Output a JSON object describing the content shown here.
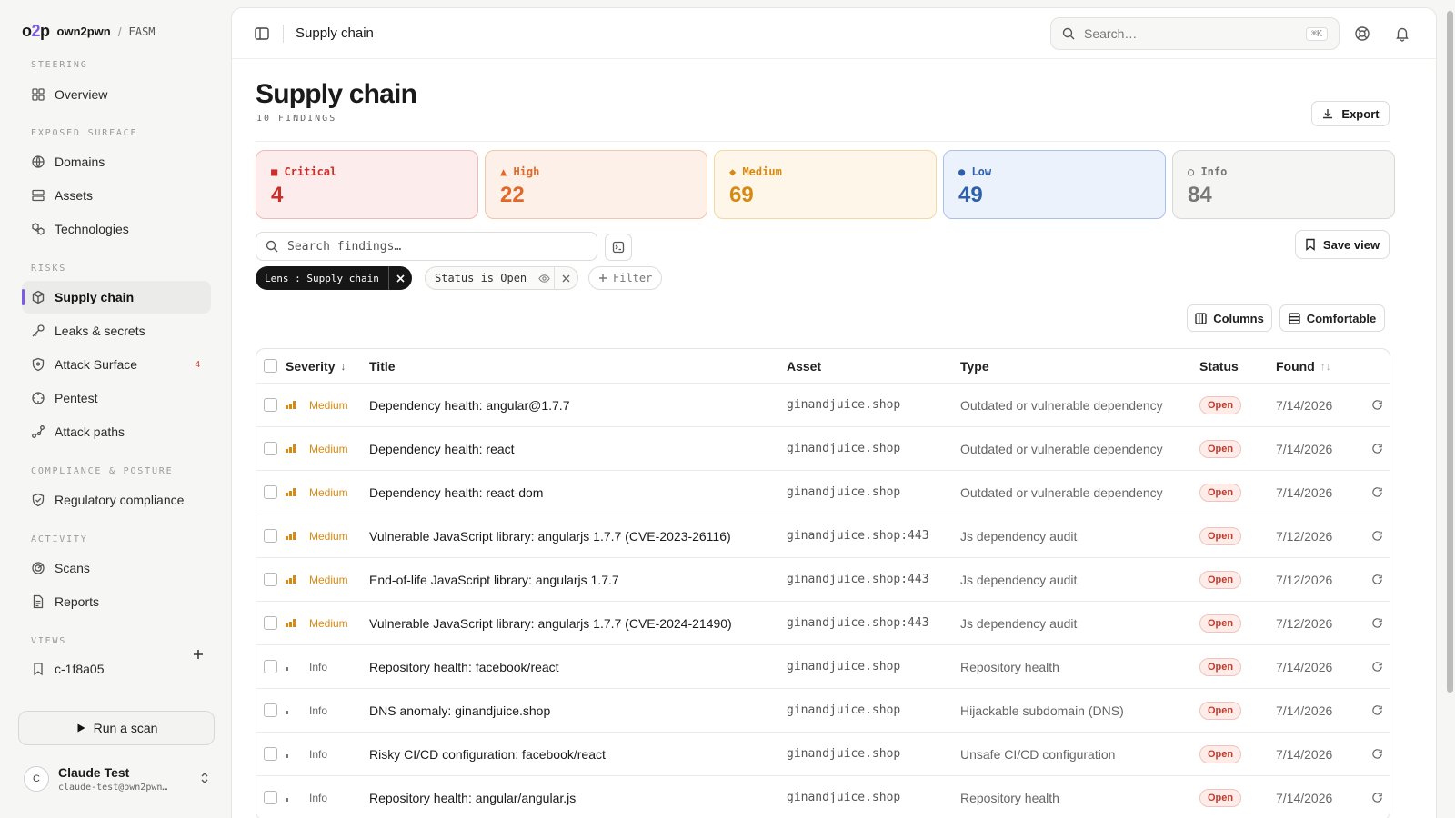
{
  "brand": {
    "logo_a": "o",
    "logo_b": "2",
    "logo_c": "p",
    "org": "own2pwn",
    "separator": "/",
    "product": "EASM"
  },
  "sidebar": {
    "sections": {
      "steering": "STEERING",
      "exposed": "EXPOSED SURFACE",
      "risks": "RISKS",
      "compliance": "COMPLIANCE & POSTURE",
      "activity": "ACTIVITY",
      "views": "VIEWS"
    },
    "items": {
      "overview": "Overview",
      "domains": "Domains",
      "assets": "Assets",
      "technologies": "Technologies",
      "supply_chain": "Supply chain",
      "leaks": "Leaks & secrets",
      "attack_surface": "Attack Surface",
      "attack_surface_badge": "4",
      "pentest": "Pentest",
      "attack_paths": "Attack paths",
      "regulatory": "Regulatory compliance",
      "scans": "Scans",
      "reports": "Reports",
      "view_1": "c-1f8a05"
    },
    "run_scan": "Run a scan",
    "user": {
      "initial": "C",
      "name": "Claude Test",
      "email": "claude-test@own2pwn…"
    }
  },
  "topbar": {
    "breadcrumb": "Supply chain",
    "search_placeholder": "Search…",
    "search_shortcut": "⌘K"
  },
  "page": {
    "title": "Supply chain",
    "subtitle": "10 FINDINGS",
    "export_label": "Export",
    "save_view_label": "Save view",
    "columns_label": "Columns",
    "density_label": "Comfortable",
    "findings_search_placeholder": "Search findings…"
  },
  "severity_cards": [
    {
      "label": "■ Critical",
      "count": "4",
      "color": "#c9302c",
      "bg": "#fcecec",
      "border": "#f0b9b6"
    },
    {
      "label": "▲ High",
      "count": "22",
      "color": "#e0692a",
      "bg": "#fdf0e8",
      "border": "#f3c6a8"
    },
    {
      "label": "◆ Medium",
      "count": "69",
      "color": "#d68a12",
      "bg": "#fdf6e9",
      "border": "#f1d9a5"
    },
    {
      "label": "● Low",
      "count": "49",
      "color": "#2f5fa8",
      "bg": "#ecf2fc",
      "border": "#a9c1ea"
    },
    {
      "label": "○ Info",
      "count": "84",
      "color": "#777777",
      "bg": "#f5f5f4",
      "border": "#d8d8d6"
    }
  ],
  "filters": {
    "lens_chip": "Lens : Supply chain",
    "status_chip": "Status is Open",
    "add_filter": "Filter"
  },
  "table": {
    "headers": {
      "severity": "Severity",
      "title": "Title",
      "asset": "Asset",
      "type": "Type",
      "status": "Status",
      "found": "Found"
    },
    "rows": [
      {
        "severity": "Medium",
        "title": "Dependency health: angular@1.7.7",
        "asset": "ginandjuice.shop",
        "type": "Outdated or vulnerable dependency",
        "status": "Open",
        "found": "7/14/2026"
      },
      {
        "severity": "Medium",
        "title": "Dependency health: react",
        "asset": "ginandjuice.shop",
        "type": "Outdated or vulnerable dependency",
        "status": "Open",
        "found": "7/14/2026"
      },
      {
        "severity": "Medium",
        "title": "Dependency health: react-dom",
        "asset": "ginandjuice.shop",
        "type": "Outdated or vulnerable dependency",
        "status": "Open",
        "found": "7/14/2026"
      },
      {
        "severity": "Medium",
        "title": "Vulnerable JavaScript library: angularjs 1.7.7 (CVE-2023-26116)",
        "asset": "ginandjuice.shop:443",
        "type": "Js dependency audit",
        "status": "Open",
        "found": "7/12/2026"
      },
      {
        "severity": "Medium",
        "title": "End-of-life JavaScript library: angularjs 1.7.7",
        "asset": "ginandjuice.shop:443",
        "type": "Js dependency audit",
        "status": "Open",
        "found": "7/12/2026"
      },
      {
        "severity": "Medium",
        "title": "Vulnerable JavaScript library: angularjs 1.7.7 (CVE-2024-21490)",
        "asset": "ginandjuice.shop:443",
        "type": "Js dependency audit",
        "status": "Open",
        "found": "7/12/2026"
      },
      {
        "severity": "Info",
        "title": "Repository health: facebook/react",
        "asset": "ginandjuice.shop",
        "type": "Repository health",
        "status": "Open",
        "found": "7/14/2026"
      },
      {
        "severity": "Info",
        "title": "DNS anomaly: ginandjuice.shop",
        "asset": "ginandjuice.shop",
        "type": "Hijackable subdomain (DNS)",
        "status": "Open",
        "found": "7/14/2026"
      },
      {
        "severity": "Info",
        "title": "Risky CI/CD configuration: facebook/react",
        "asset": "ginandjuice.shop",
        "type": "Unsafe CI/CD configuration",
        "status": "Open",
        "found": "7/14/2026"
      },
      {
        "severity": "Info",
        "title": "Repository health: angular/angular.js",
        "asset": "ginandjuice.shop",
        "type": "Repository health",
        "status": "Open",
        "found": "7/14/2026"
      }
    ]
  }
}
